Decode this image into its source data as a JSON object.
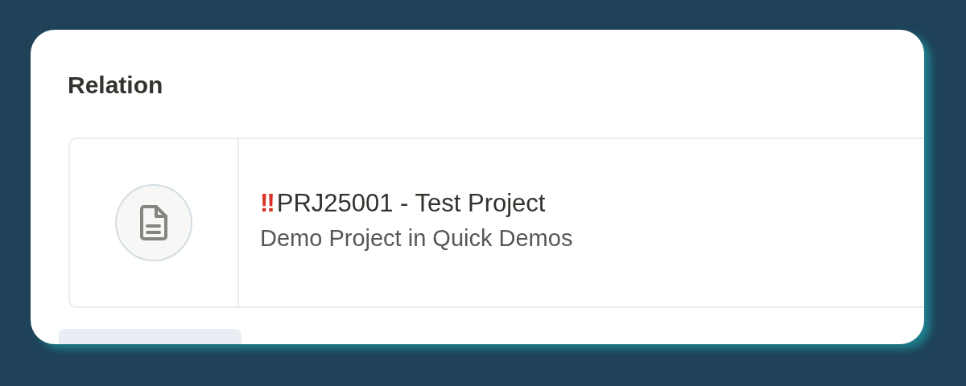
{
  "section": {
    "title": "Relation"
  },
  "relation": {
    "priority_mark": "‼",
    "title": "PRJ25001 - Test Project",
    "subtitle": "Demo Project in Quick Demos"
  }
}
